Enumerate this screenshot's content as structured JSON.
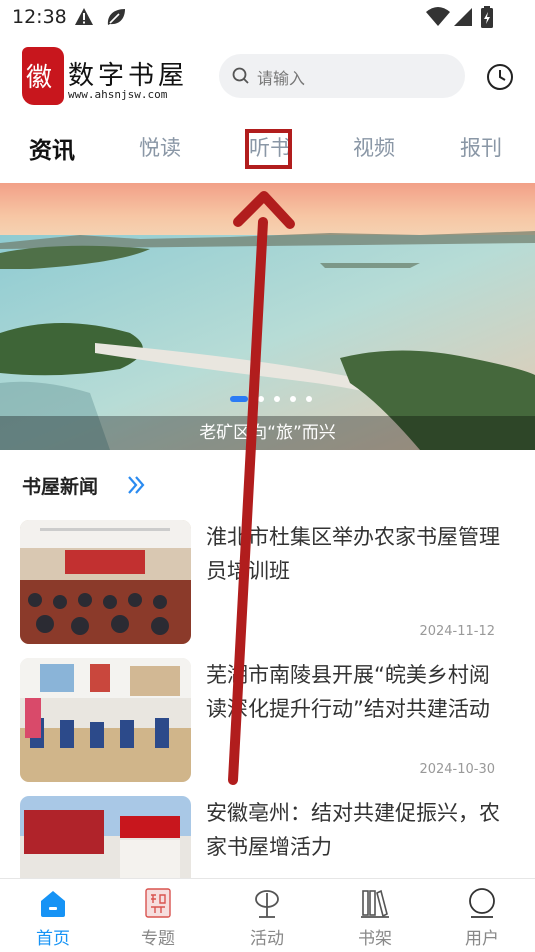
{
  "status_bar": {
    "time": "12:38"
  },
  "header": {
    "logo_name": "数字书屋",
    "logo_url": "www.ahsnjsw.com",
    "search_placeholder": "请输入"
  },
  "tabs": [
    {
      "label": "资讯",
      "active": true
    },
    {
      "label": "悦读",
      "active": false
    },
    {
      "label": "听书",
      "active": false,
      "highlighted": true
    },
    {
      "label": "视频",
      "active": false
    },
    {
      "label": "报刊",
      "active": false
    }
  ],
  "banner": {
    "caption": "老矿区向“旅”而兴",
    "pages": 5,
    "current_page": 1
  },
  "section": {
    "title": "书屋新闻"
  },
  "news": [
    {
      "title": "淮北市杜集区举办农家书屋管理员培训班",
      "date": "2024-11-12"
    },
    {
      "title": "芜湖市南陵县开展“皖美乡村阅读深化提升行动”结对共建活动",
      "date": "2024-10-30"
    },
    {
      "title": "安徽亳州：结对共建促振兴，农家书屋增活力",
      "date": ""
    }
  ],
  "bottom_nav": [
    {
      "label": "首页",
      "icon": "home-icon",
      "active": true
    },
    {
      "label": "专题",
      "icon": "seal-icon",
      "active": false
    },
    {
      "label": "活动",
      "icon": "sprout-icon",
      "active": false
    },
    {
      "label": "书架",
      "icon": "bookshelf-icon",
      "active": false
    },
    {
      "label": "用户",
      "icon": "user-icon",
      "active": false
    }
  ],
  "colors": {
    "accent": "#1693f5",
    "highlight": "#b11d1d",
    "brand_red": "#c8161d"
  }
}
